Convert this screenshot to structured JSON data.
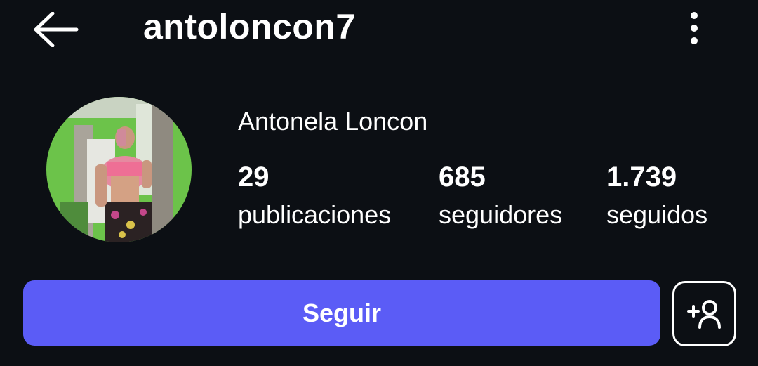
{
  "header": {
    "username": "antoloncon7",
    "back_icon": "arrow-left-icon",
    "more_icon": "more-vertical-icon"
  },
  "profile": {
    "full_name": "Antonela Loncon",
    "stats": [
      {
        "value": "29",
        "label": "publicaciones"
      },
      {
        "value": "685",
        "label": "seguidores"
      },
      {
        "value": "1.739",
        "label": "seguidos"
      }
    ]
  },
  "actions": {
    "follow_label": "Seguir",
    "suggest_icon": "add-person-icon"
  },
  "colors": {
    "background": "#0c0f14",
    "follow_button": "#5b5cf6",
    "text": "#ffffff"
  }
}
